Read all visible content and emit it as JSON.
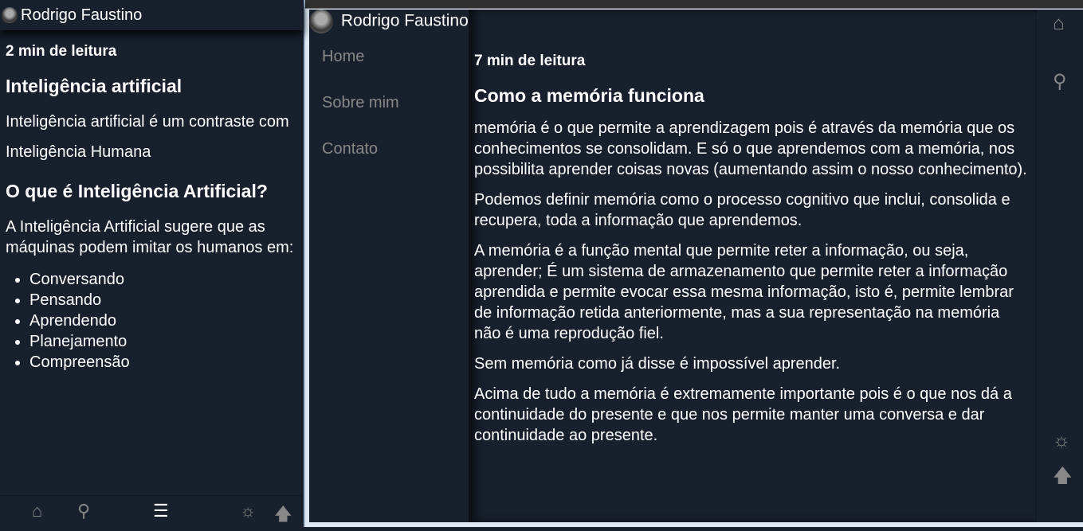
{
  "left": {
    "author": "Rodrigo Faustino",
    "reading_time": "2 min de leitura",
    "title": "Inteligência artificial",
    "paragraphs": [
      "Inteligência artificial é um contraste com",
      "Inteligência Humana"
    ],
    "subtitle": "O que é Inteligência Artificial?",
    "intro": "A Inteligência Artificial sugere que as máquinas podem imitar os humanos em:",
    "list": [
      "Conversando",
      "Pensando",
      "Aprendendo",
      "Planejamento",
      "Compreensão"
    ],
    "footer_icons": [
      "home-icon",
      "search-icon",
      "menu-icon",
      "theme-icon",
      "arrow-up-icon"
    ]
  },
  "right": {
    "author": "Rodrigo Faustino",
    "nav": [
      "Home",
      "Sobre mim",
      "Contato"
    ],
    "reading_time": "7 min de leitura",
    "title": "Como a memória funciona",
    "paragraphs": [
      "memória é o que permite a aprendizagem pois é através da memória que os conhecimentos se consolidam. E só o que aprendemos com a memória, nos possibilita aprender coisas novas (aumentando assim o nosso conhecimento).",
      "Podemos definir memória como o processo cognitivo que inclui, consolida e recupera, toda a informação que aprendemos.",
      "A memória é a função mental que permite reter a informação, ou seja, aprender; É um sistema de armazenamento que permite reter a informação aprendida e permite evocar essa mesma informação, isto é, permite lembrar de informação retida anteriormente, mas a sua representação na memória não é uma reprodução fiel.",
      "Sem memória como já disse é impossível aprender.",
      "Acima de tudo a memória é extremamente importante pois é o que nos dá a continuidade do presente e que nos permite manter uma conversa e dar continuidade ao presente."
    ],
    "rail_icons": [
      "home-icon",
      "search-icon",
      "theme-icon",
      "arrow-up-icon"
    ]
  }
}
